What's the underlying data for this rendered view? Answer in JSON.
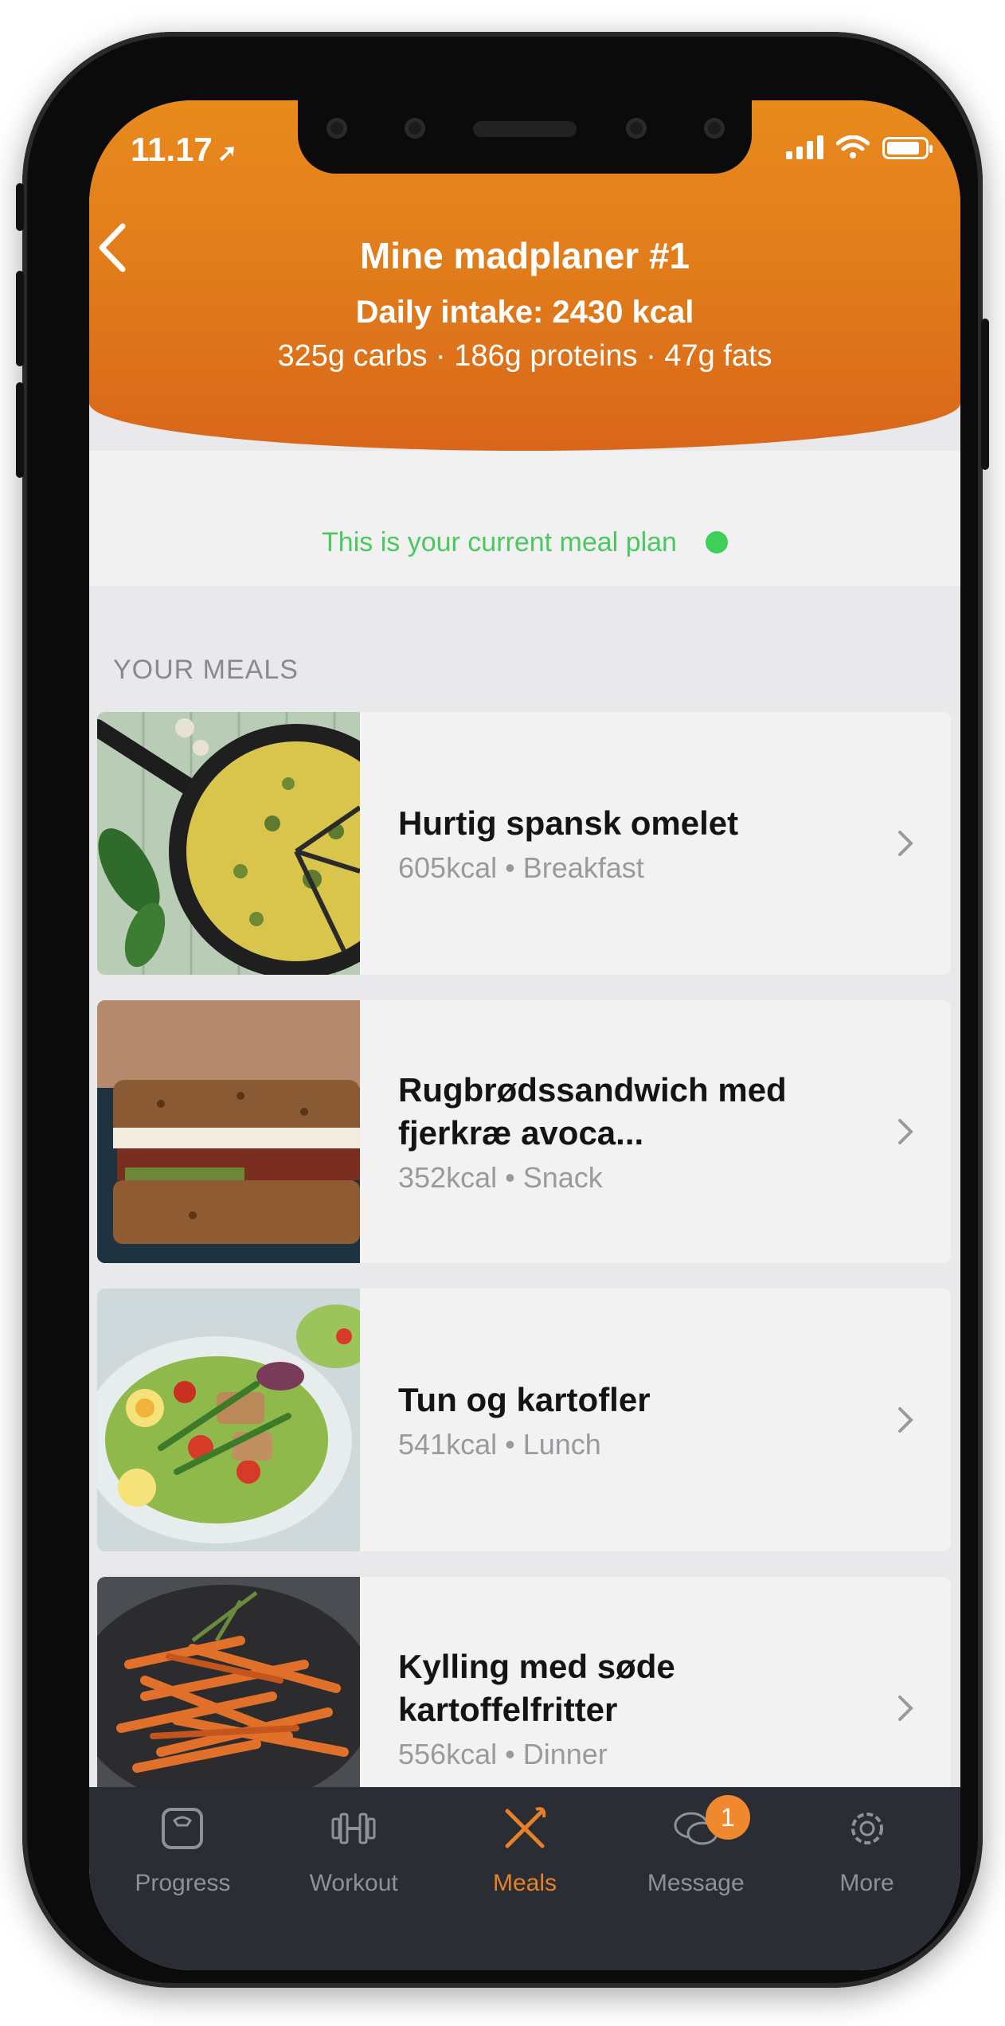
{
  "status": {
    "time": "11.17"
  },
  "header": {
    "title": "Mine madplaner #1",
    "daily_intake": "Daily intake: 2430 kcal",
    "macros": "325g carbs · 186g proteins · 47g fats"
  },
  "current_plan": {
    "text": "This is your current meal plan",
    "status_color": "#3ecf5a"
  },
  "section_label": "YOUR MEALS",
  "meals": [
    {
      "name": "Hurtig spansk omelet",
      "meta": "605kcal • Breakfast",
      "image": "omelette-photo"
    },
    {
      "name": "Rugbrødssandwich med fjerkræ avoca...",
      "meta": "352kcal • Snack",
      "image": "sandwich-photo"
    },
    {
      "name": "Tun og kartofler",
      "meta": "541kcal • Lunch",
      "image": "tuna-salad-photo"
    },
    {
      "name": "Kylling med søde kartoffelfritter",
      "meta": "556kcal • Dinner",
      "image": "sweet-potato-fries-photo"
    }
  ],
  "tabs": [
    {
      "label": "Progress",
      "icon": "scale-icon"
    },
    {
      "label": "Workout",
      "icon": "dumbbell-icon"
    },
    {
      "label": "Meals",
      "icon": "fork-knife-icon",
      "active": true
    },
    {
      "label": "Message",
      "icon": "chat-icon",
      "badge": "1"
    },
    {
      "label": "More",
      "icon": "gear-icon"
    }
  ],
  "colors": {
    "accent": "#e8802a",
    "header": "#e07a1b",
    "tabbar": "#2a2d33"
  }
}
